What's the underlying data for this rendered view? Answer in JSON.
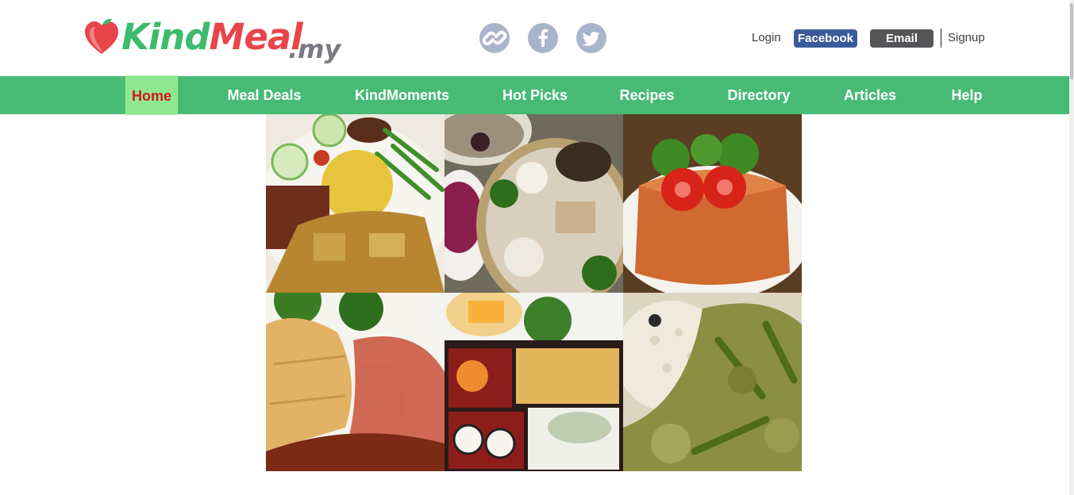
{
  "brand": {
    "name_part1": "Kind",
    "name_part2": "Meal",
    "tld": ".my"
  },
  "social": [
    {
      "name": "link-icon"
    },
    {
      "name": "facebook-icon"
    },
    {
      "name": "twitter-icon"
    }
  ],
  "auth": {
    "login": "Login",
    "facebook": "Facebook",
    "email": "Email",
    "signup": "Signup"
  },
  "nav": {
    "items": [
      {
        "label": "Home",
        "active": true
      },
      {
        "label": "Meal Deals"
      },
      {
        "label": "KindMoments"
      },
      {
        "label": "Hot Picks"
      },
      {
        "label": "Recipes"
      },
      {
        "label": "Directory"
      },
      {
        "label": "Articles"
      },
      {
        "label": "Help"
      }
    ]
  },
  "colors": {
    "brand_green": "#47bb74",
    "brand_red": "#e8454a",
    "active_bg": "#8ee88f",
    "active_text": "#d31818",
    "facebook_blue": "#3b5a9a"
  }
}
